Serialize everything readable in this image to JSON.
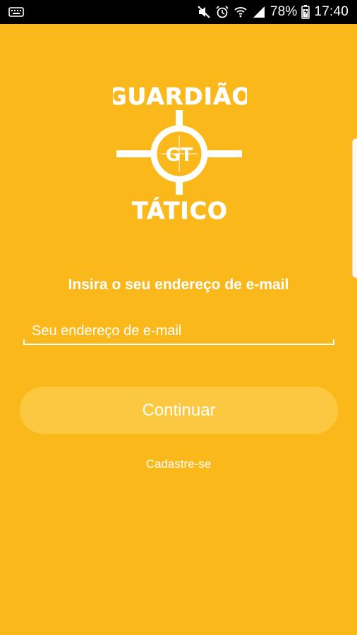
{
  "status_bar": {
    "battery_percent": "78%",
    "time": "17:40",
    "icons": [
      "keyboard-icon",
      "mute-icon",
      "alarm-icon",
      "wifi-icon",
      "signal-icon",
      "battery-icon"
    ]
  },
  "logo": {
    "line1": "GUARDIÃO",
    "center": "GT",
    "line2": "TÁTICO",
    "color": "#FFFFFF"
  },
  "form": {
    "prompt": "Insira o seu endereço de e-mail",
    "email_placeholder": "Seu endereço de e-mail",
    "email_value": ""
  },
  "actions": {
    "continue_label": "Continuar",
    "signup_label": "Cadastre-se"
  },
  "colors": {
    "background": "#FBB81B",
    "button": "#FCC840",
    "text": "#FFFFFF"
  }
}
